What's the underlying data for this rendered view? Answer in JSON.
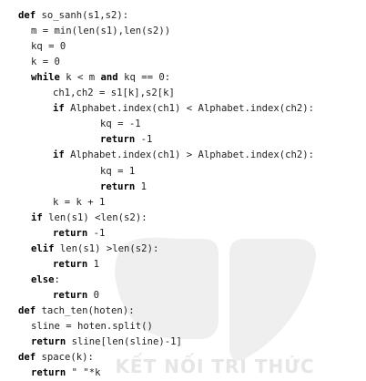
{
  "watermark": {
    "text": "KẾT NỐI TRI THỨC",
    "color": "#e6e6e6"
  },
  "code": {
    "lines": [
      {
        "indent": 0,
        "tokens": [
          {
            "t": "def",
            "kw": true
          },
          {
            "t": " so_sanh(s1,s2):"
          }
        ]
      },
      {
        "indent": 1,
        "tokens": [
          {
            "t": "m = min(len(s1),len(s2))"
          }
        ]
      },
      {
        "indent": 1,
        "tokens": [
          {
            "t": "kq = 0"
          }
        ]
      },
      {
        "indent": 1,
        "tokens": [
          {
            "t": "k = 0"
          }
        ]
      },
      {
        "indent": 1,
        "tokens": [
          {
            "t": "while",
            "kw": true
          },
          {
            "t": " k < m "
          },
          {
            "t": "and",
            "kw": true
          },
          {
            "t": " kq == 0:"
          }
        ]
      },
      {
        "indent": 2,
        "tokens": [
          {
            "t": "ch1,ch2 = s1[k],s2[k]"
          }
        ]
      },
      {
        "indent": 2,
        "tokens": [
          {
            "t": "if",
            "kw": true
          },
          {
            "t": " Alphabet.index(ch1) < Alphabet.index(ch2):"
          }
        ]
      },
      {
        "indent": 4,
        "tokens": [
          {
            "t": "kq = -1"
          }
        ]
      },
      {
        "indent": 4,
        "tokens": [
          {
            "t": "return",
            "kw": true
          },
          {
            "t": " -1"
          }
        ]
      },
      {
        "indent": 2,
        "tokens": [
          {
            "t": "if",
            "kw": true
          },
          {
            "t": " Alphabet.index(ch1) > Alphabet.index(ch2):"
          }
        ]
      },
      {
        "indent": 4,
        "tokens": [
          {
            "t": "kq = 1"
          }
        ]
      },
      {
        "indent": 4,
        "tokens": [
          {
            "t": "return",
            "kw": true
          },
          {
            "t": " 1"
          }
        ]
      },
      {
        "indent": 2,
        "tokens": [
          {
            "t": "k = k + 1"
          }
        ]
      },
      {
        "indent": 1,
        "tokens": [
          {
            "t": "if",
            "kw": true
          },
          {
            "t": " len(s1) <len(s2):"
          }
        ]
      },
      {
        "indent": 2,
        "tokens": [
          {
            "t": "return",
            "kw": true
          },
          {
            "t": " -1"
          }
        ]
      },
      {
        "indent": 1,
        "tokens": [
          {
            "t": "elif",
            "kw": true
          },
          {
            "t": " len(s1) >len(s2):"
          }
        ]
      },
      {
        "indent": 2,
        "tokens": [
          {
            "t": "return",
            "kw": true
          },
          {
            "t": " 1"
          }
        ]
      },
      {
        "indent": 1,
        "tokens": [
          {
            "t": "else",
            "kw": true
          },
          {
            "t": ":"
          }
        ]
      },
      {
        "indent": 2,
        "tokens": [
          {
            "t": "return",
            "kw": true
          },
          {
            "t": " 0"
          }
        ]
      },
      {
        "indent": 0,
        "tokens": [
          {
            "t": "def",
            "kw": true
          },
          {
            "t": " tach_ten(hoten):"
          }
        ]
      },
      {
        "indent": 1,
        "tokens": [
          {
            "t": "sline = hoten.split()"
          }
        ]
      },
      {
        "indent": 1,
        "tokens": [
          {
            "t": "return",
            "kw": true
          },
          {
            "t": " sline[len(sline)-1]"
          }
        ]
      },
      {
        "indent": 0,
        "tokens": [
          {
            "t": "def",
            "kw": true
          },
          {
            "t": " space(k):"
          }
        ]
      },
      {
        "indent": 1,
        "tokens": [
          {
            "t": "return",
            "kw": true
          },
          {
            "t": " \" \"*k"
          }
        ]
      }
    ]
  }
}
